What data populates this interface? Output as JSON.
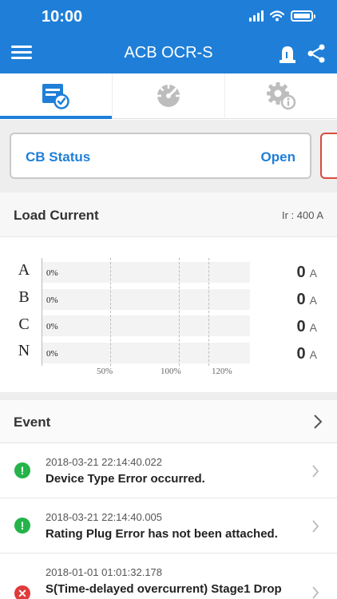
{
  "status_bar": {
    "time": "10:00"
  },
  "app_bar": {
    "title": "ACB OCR-S"
  },
  "tabs": [
    {
      "name": "status-tab",
      "icon": "status-report-icon",
      "active": true
    },
    {
      "name": "gauge-tab",
      "icon": "gauge-icon",
      "active": false
    },
    {
      "name": "settings-info-tab",
      "icon": "settings-info-icon",
      "active": false
    }
  ],
  "cb_status": {
    "label": "CB Status",
    "value": "Open"
  },
  "load_current": {
    "title": "Load Current",
    "ir": "Ir : 400 A",
    "phases": [
      {
        "label": "A",
        "percent": "0%",
        "value": "0",
        "unit": "A"
      },
      {
        "label": "B",
        "percent": "0%",
        "value": "0",
        "unit": "A"
      },
      {
        "label": "C",
        "percent": "0%",
        "value": "0",
        "unit": "A"
      },
      {
        "label": "N",
        "percent": "0%",
        "value": "0",
        "unit": "A"
      }
    ],
    "ticks": [
      "50%",
      "100%",
      "120%"
    ]
  },
  "chart_data": {
    "type": "bar",
    "categories": [
      "A",
      "B",
      "C",
      "N"
    ],
    "values": [
      0,
      0,
      0,
      0
    ],
    "x_ticks": [
      "50%",
      "100%",
      "120%"
    ],
    "title": "Load Current"
  },
  "events": {
    "title": "Event",
    "items": [
      {
        "time": "2018-03-21 22:14:40.022",
        "message": "Device Type Error occurred.",
        "severity": "warning",
        "icon": "exclamation-icon",
        "color": "#25b34a"
      },
      {
        "time": "2018-03-21 22:14:40.005",
        "message": "Rating Plug Error has not been attached.",
        "severity": "warning",
        "icon": "exclamation-icon",
        "color": "#25b34a"
      },
      {
        "time": "2018-01-01 01:01:32.178",
        "message": "S(Time-delayed overcurrent) Stage1 Drop",
        "severity": "error",
        "icon": "error-x-icon",
        "color": "#e03a3a"
      }
    ]
  },
  "colors": {
    "primary": "#1f7fd8",
    "open_border": "#d94a3c"
  }
}
